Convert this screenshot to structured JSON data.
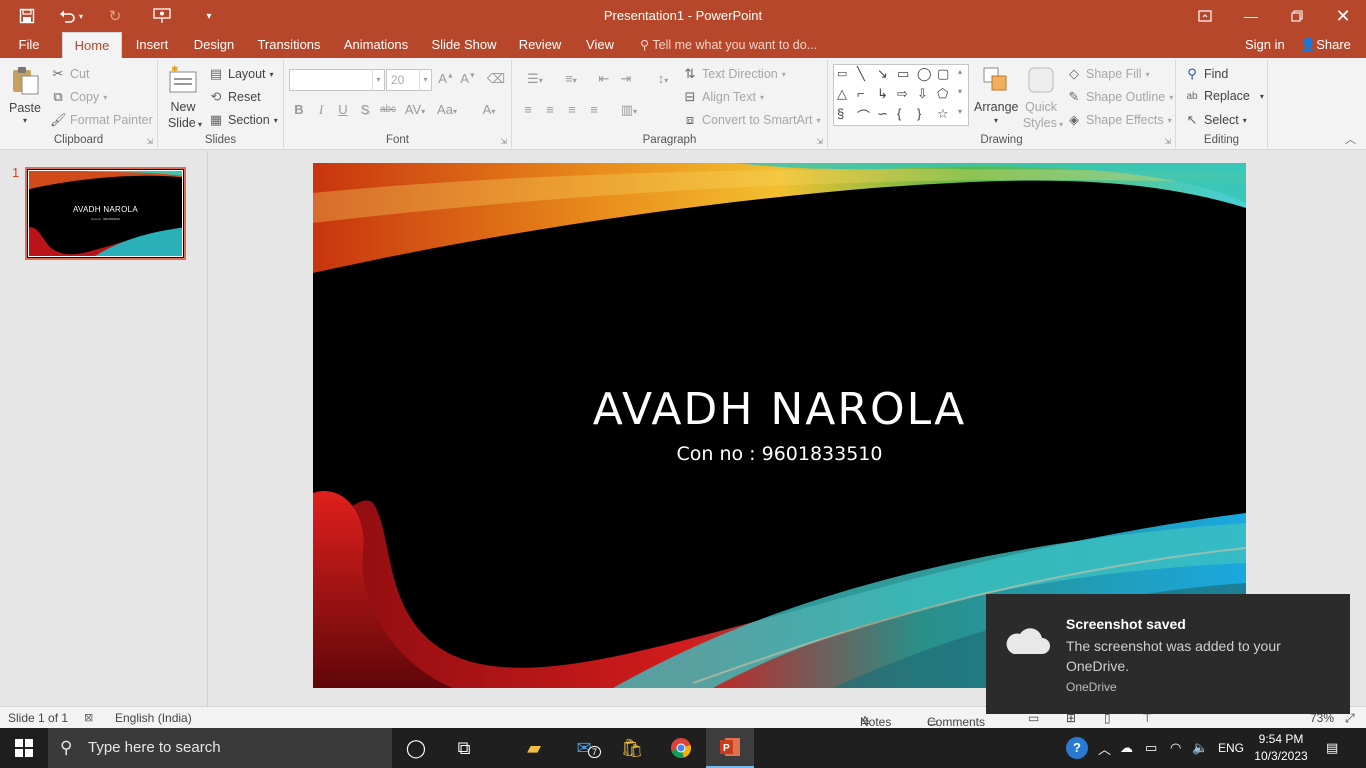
{
  "window": {
    "title": "Presentation1 - PowerPoint",
    "colors": {
      "accent": "#b7472a",
      "ribbon_bg": "#f3f3f3",
      "taskbar_bg": "#1f1f1f"
    }
  },
  "quick_access": {
    "save_icon": "save-icon",
    "undo_icon": "undo-icon",
    "redo_icon": "redo-icon",
    "presenter_icon": "start-slideshow-icon",
    "customize_icon": "customize-qat-icon"
  },
  "tabs": [
    "File",
    "Home",
    "Insert",
    "Design",
    "Transitions",
    "Animations",
    "Slide Show",
    "Review",
    "View"
  ],
  "active_tab": "Home",
  "tell_me": "Tell me what you want to do...",
  "account": {
    "sign_in": "Sign in",
    "share": "Share"
  },
  "ribbon": {
    "clipboard": {
      "label": "Clipboard",
      "paste": "Paste",
      "cut": "Cut",
      "copy": "Copy",
      "format_painter": "Format Painter"
    },
    "slides": {
      "label": "Slides",
      "new_slide_1": "New",
      "new_slide_2": "Slide",
      "layout": "Layout",
      "reset": "Reset",
      "section": "Section"
    },
    "font": {
      "label": "Font",
      "font_name": "",
      "font_size": "20",
      "bold": "B",
      "italic": "I",
      "underline": "U",
      "shadow": "S",
      "strike": "abc",
      "spacing": "AV",
      "case": "Aa",
      "color": "A"
    },
    "paragraph": {
      "label": "Paragraph",
      "text_direction": "Text Direction",
      "align_text": "Align Text",
      "convert_smartart": "Convert to SmartArt"
    },
    "drawing": {
      "label": "Drawing",
      "arrange": "Arrange",
      "quick_styles_1": "Quick",
      "quick_styles_2": "Styles",
      "shape_fill": "Shape Fill",
      "shape_outline": "Shape Outline",
      "shape_effects": "Shape Effects"
    },
    "editing": {
      "label": "Editing",
      "find": "Find",
      "replace": "Replace",
      "select": "Select"
    }
  },
  "thumbnails": [
    {
      "number": "1",
      "title": "AVADH NAROLA",
      "subtitle": "Con no : 9601833510"
    }
  ],
  "slide": {
    "title": "AVADH NAROLA",
    "subtitle": "Con no : 9601833510"
  },
  "status_bar": {
    "slide_info": "Slide 1 of 1",
    "language": "English (India)",
    "notes": "Notes",
    "comments": "Comments",
    "zoom": "73%"
  },
  "toast": {
    "title": "Screenshot saved",
    "body": "The screenshot was added to your OneDrive.",
    "source": "OneDrive"
  },
  "taskbar": {
    "search_placeholder": "Type here to search",
    "mail_badge": "7",
    "language": "ENG",
    "time": "9:54 PM",
    "date": "10/3/2023"
  }
}
